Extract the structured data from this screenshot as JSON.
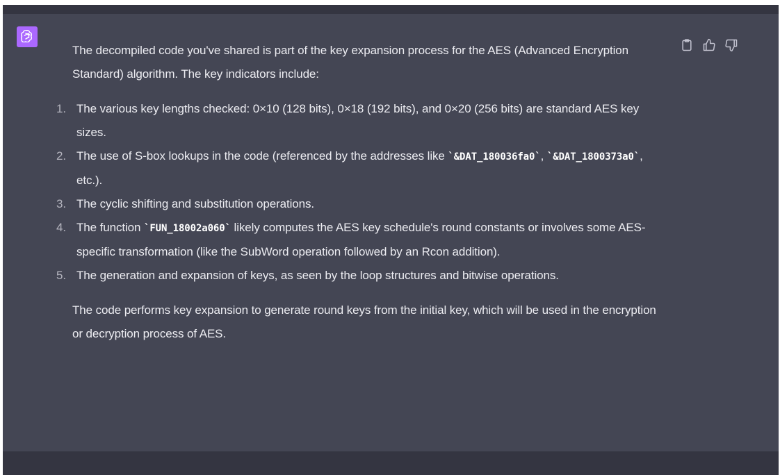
{
  "message": {
    "intro": "The decompiled code you've shared is part of the key expansion process for the AES (Advanced Encryption Standard) algorithm. The key indicators include:",
    "items": [
      {
        "number": "1.",
        "text": "The various key lengths checked: 0×10 (128 bits), 0×18 (192 bits), and 0×20 (256 bits) are standard AES key sizes."
      },
      {
        "number": "2.",
        "pre": "The use of S-box lookups in the code (referenced by the addresses like ",
        "code1": "`&DAT_180036fa0`",
        "mid": ", ",
        "code2": "`&DAT_1800373a0`",
        "post": ", etc.)."
      },
      {
        "number": "3.",
        "text": "The cyclic shifting and substitution operations."
      },
      {
        "number": "4.",
        "pre": "The function ",
        "code1": "`FUN_18002a060`",
        "post": " likely computes the AES key schedule's round constants or involves some AES-specific transformation (like the SubWord operation followed by an Rcon addition)."
      },
      {
        "number": "5.",
        "text": "The generation and expansion of keys, as seen by the loop structures and bitwise operations."
      }
    ],
    "conclusion": "The code performs key expansion to generate round keys from the initial key, which will be used in the encryption or decryption process of AES."
  },
  "icons": {
    "avatar": "openai-logo-icon",
    "copy": "clipboard-icon",
    "like": "thumbs-up-icon",
    "dislike": "thumbs-down-icon"
  },
  "colors": {
    "message_bg": "#444654",
    "page_bg": "#343541",
    "avatar_bg": "#ab68ff",
    "text": "#ececf1"
  }
}
